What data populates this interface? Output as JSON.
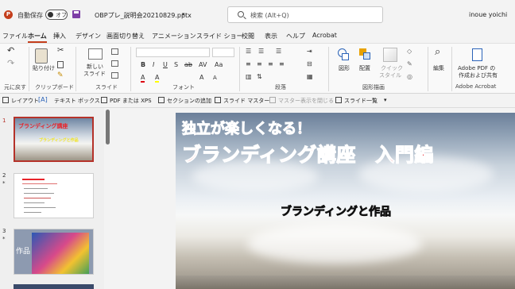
{
  "titlebar": {
    "app_logo": "P",
    "autosave_label": "自動保存",
    "autosave_state": "オフ",
    "filename": "OBPプレ_説明会20210829.pptx",
    "search_placeholder": "検索 (Alt+Q)",
    "user_name": "inoue yoichi"
  },
  "menu": [
    "ファイル",
    "ホーム",
    "挿入",
    "デザイン",
    "画面切り替え",
    "アニメーション",
    "スライド ショー",
    "校閲",
    "表示",
    "ヘルプ",
    "Acrobat"
  ],
  "ribbon": {
    "groups": {
      "undo": "元に戻す",
      "clipboard": "クリップボード",
      "slides": "スライド",
      "font": "フォント",
      "paragraph": "段落",
      "drawing": "図形描画",
      "adobe": "Adobe Acrobat"
    },
    "buttons": {
      "paste": "貼り付け",
      "new_slide_1": "新しい",
      "new_slide_2": "スライド",
      "shapes": "図形",
      "arrange": "配置",
      "quick_styles_1": "クイック",
      "quick_styles_2": "スタイル",
      "edit": "編集",
      "adobe_pdf_1": "Adobe PDF の",
      "adobe_pdf_2": "作成および共有"
    },
    "font_tools": [
      "B",
      "I",
      "U",
      "S",
      "ab",
      "AV",
      "Aa",
      "A",
      "A",
      "A",
      "A"
    ]
  },
  "qat": {
    "layout": "レイアウト",
    "textbox": "テキスト ボックス",
    "pdf_xps": "PDF または XPS",
    "add_section": "セクションの追加",
    "slide_master": "スライド マスター",
    "close_master": "マスター表示を閉じる",
    "slide_list": "スライド一覧"
  },
  "thumbnails": [
    {
      "num": "1",
      "title": "ブランディング講座",
      "subtitle": "ブランディングと作品"
    },
    {
      "num": "2",
      "star": "*"
    },
    {
      "num": "3",
      "star": "*",
      "label": "作品"
    }
  ],
  "slide": {
    "title_line1": "独立が楽しくなる！",
    "title_line2": "ブランディング講座　入門編",
    "subtitle": "ブランディングと作品"
  },
  "colors": {
    "accent": "#c43e1c",
    "title_red": "#e8232a",
    "subtitle_yellow": "#f4e51c"
  }
}
